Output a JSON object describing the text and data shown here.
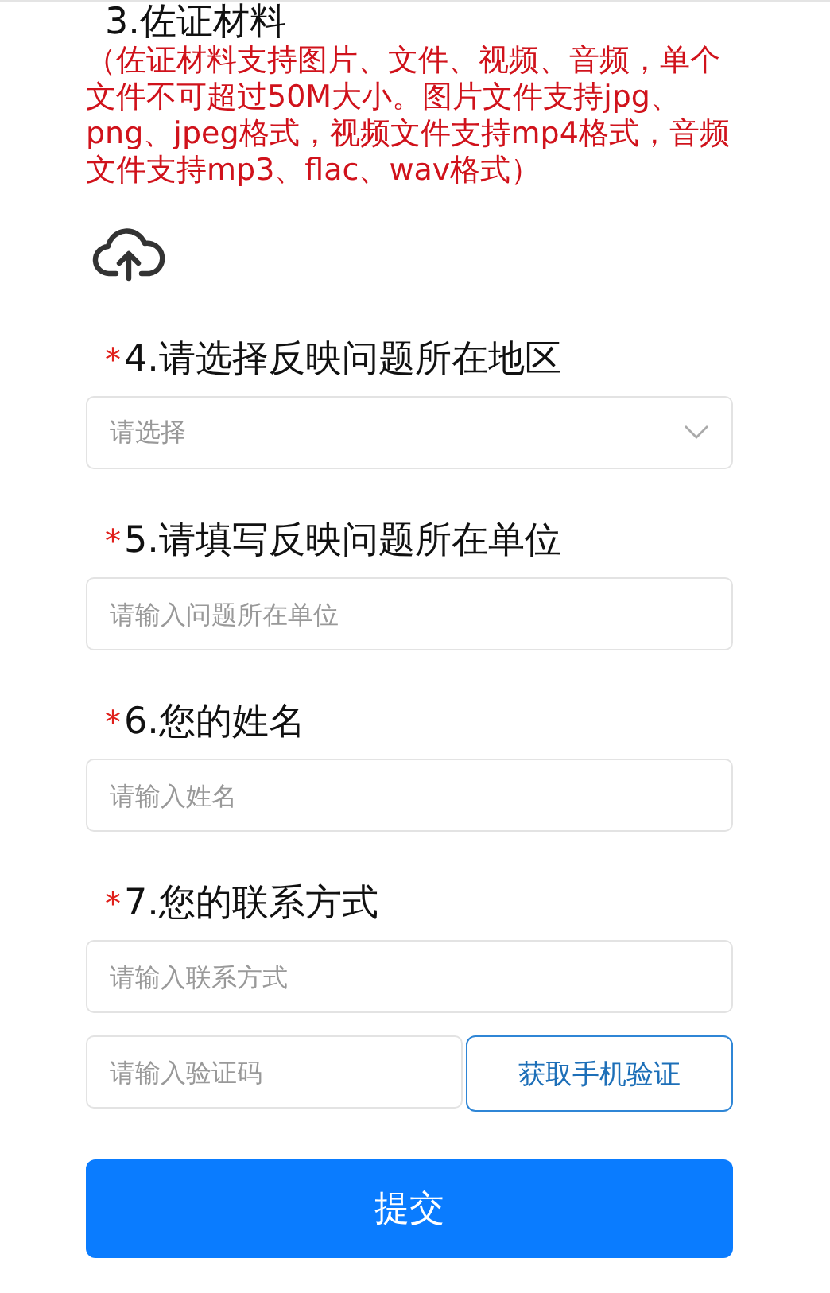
{
  "evidence": {
    "title": "3.佐证材料",
    "note": "（佐证材料支持图片、文件、视频、音频，单个文件不可超过50M大小。图片文件支持jpg、png、jpeg格式，视频文件支持mp4格式，音频文件支持mp3、flac、wav格式）"
  },
  "questions": [
    {
      "title": "4.请选择反映问题所在地区",
      "required_mark": "*",
      "fields": [
        {
          "kind": "select",
          "placeholder": "请选择"
        }
      ]
    },
    {
      "title": "5.请填写反映问题所在单位",
      "required_mark": "*",
      "fields": [
        {
          "kind": "text",
          "placeholder": "请输入问题所在单位"
        }
      ]
    },
    {
      "title": "6.您的姓名",
      "required_mark": "*",
      "fields": [
        {
          "kind": "text",
          "placeholder": "请输入姓名"
        }
      ]
    },
    {
      "title": "7.您的联系方式",
      "required_mark": "*",
      "fields": [
        {
          "kind": "text",
          "placeholder": "请输入联系方式"
        },
        {
          "kind": "code",
          "placeholder": "请输入验证码",
          "button": "获取手机验证"
        }
      ]
    }
  ],
  "submit": "提交"
}
